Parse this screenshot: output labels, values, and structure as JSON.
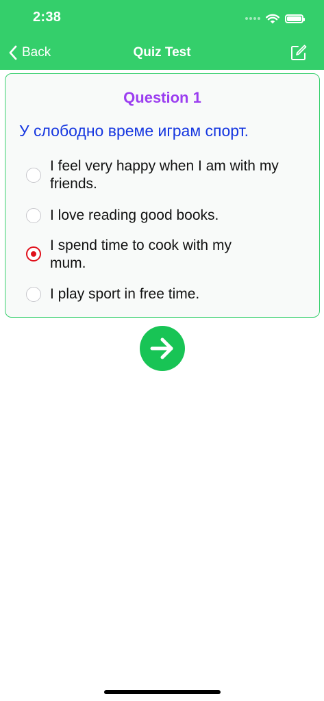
{
  "status_bar": {
    "time": "2:38"
  },
  "nav": {
    "back_label": "Back",
    "title": "Quiz Test",
    "edit_icon": "compose-icon"
  },
  "question": {
    "number_label": "Question 1",
    "text": "У слободно време играм спорт.",
    "options": [
      {
        "label": "I feel very happy when I am with my friends.",
        "selected": false
      },
      {
        "label": "I love reading good books.",
        "selected": false
      },
      {
        "label": "I spend time to cook with my mum.",
        "selected": true
      },
      {
        "label": "I play sport in free time.",
        "selected": false
      }
    ]
  },
  "next_button": {
    "icon": "arrow-right-icon"
  },
  "colors": {
    "header_green": "#34cf6b",
    "button_green": "#18c455",
    "question_number_purple": "#9b3df0",
    "question_text_blue": "#1536e0",
    "selected_radio_red": "#e0101b"
  }
}
